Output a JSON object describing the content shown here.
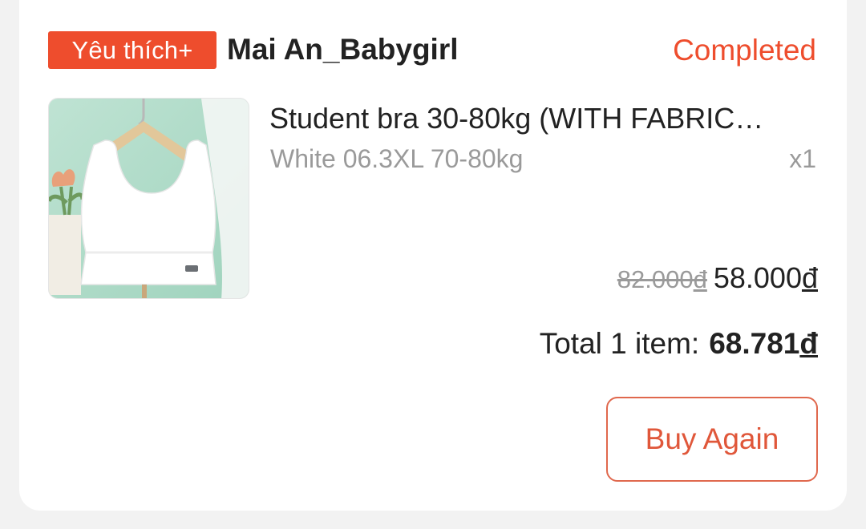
{
  "shop": {
    "badge": "Yêu thích+",
    "name": "Mai An_Babygirl",
    "status": "Completed"
  },
  "product": {
    "name": "Student bra 30-80kg (WITH FABRIC…",
    "variant": "White 06.3XL 70-80kg",
    "quantity": "x1",
    "price_original_value": "82.000",
    "price_original_currency": "đ",
    "price_current_value": "58.000",
    "price_current_currency": "đ",
    "image_icon": "product-photo-white-bra-on-hanger"
  },
  "order": {
    "total_label": "Total 1 item:",
    "total_value": "68.781",
    "total_currency": "đ"
  },
  "actions": {
    "buy_again_label": "Buy Again"
  },
  "colors": {
    "accent": "#ee4d2d",
    "button_border": "#e0684d",
    "muted_text": "#9a9a9a",
    "text": "#222222"
  }
}
